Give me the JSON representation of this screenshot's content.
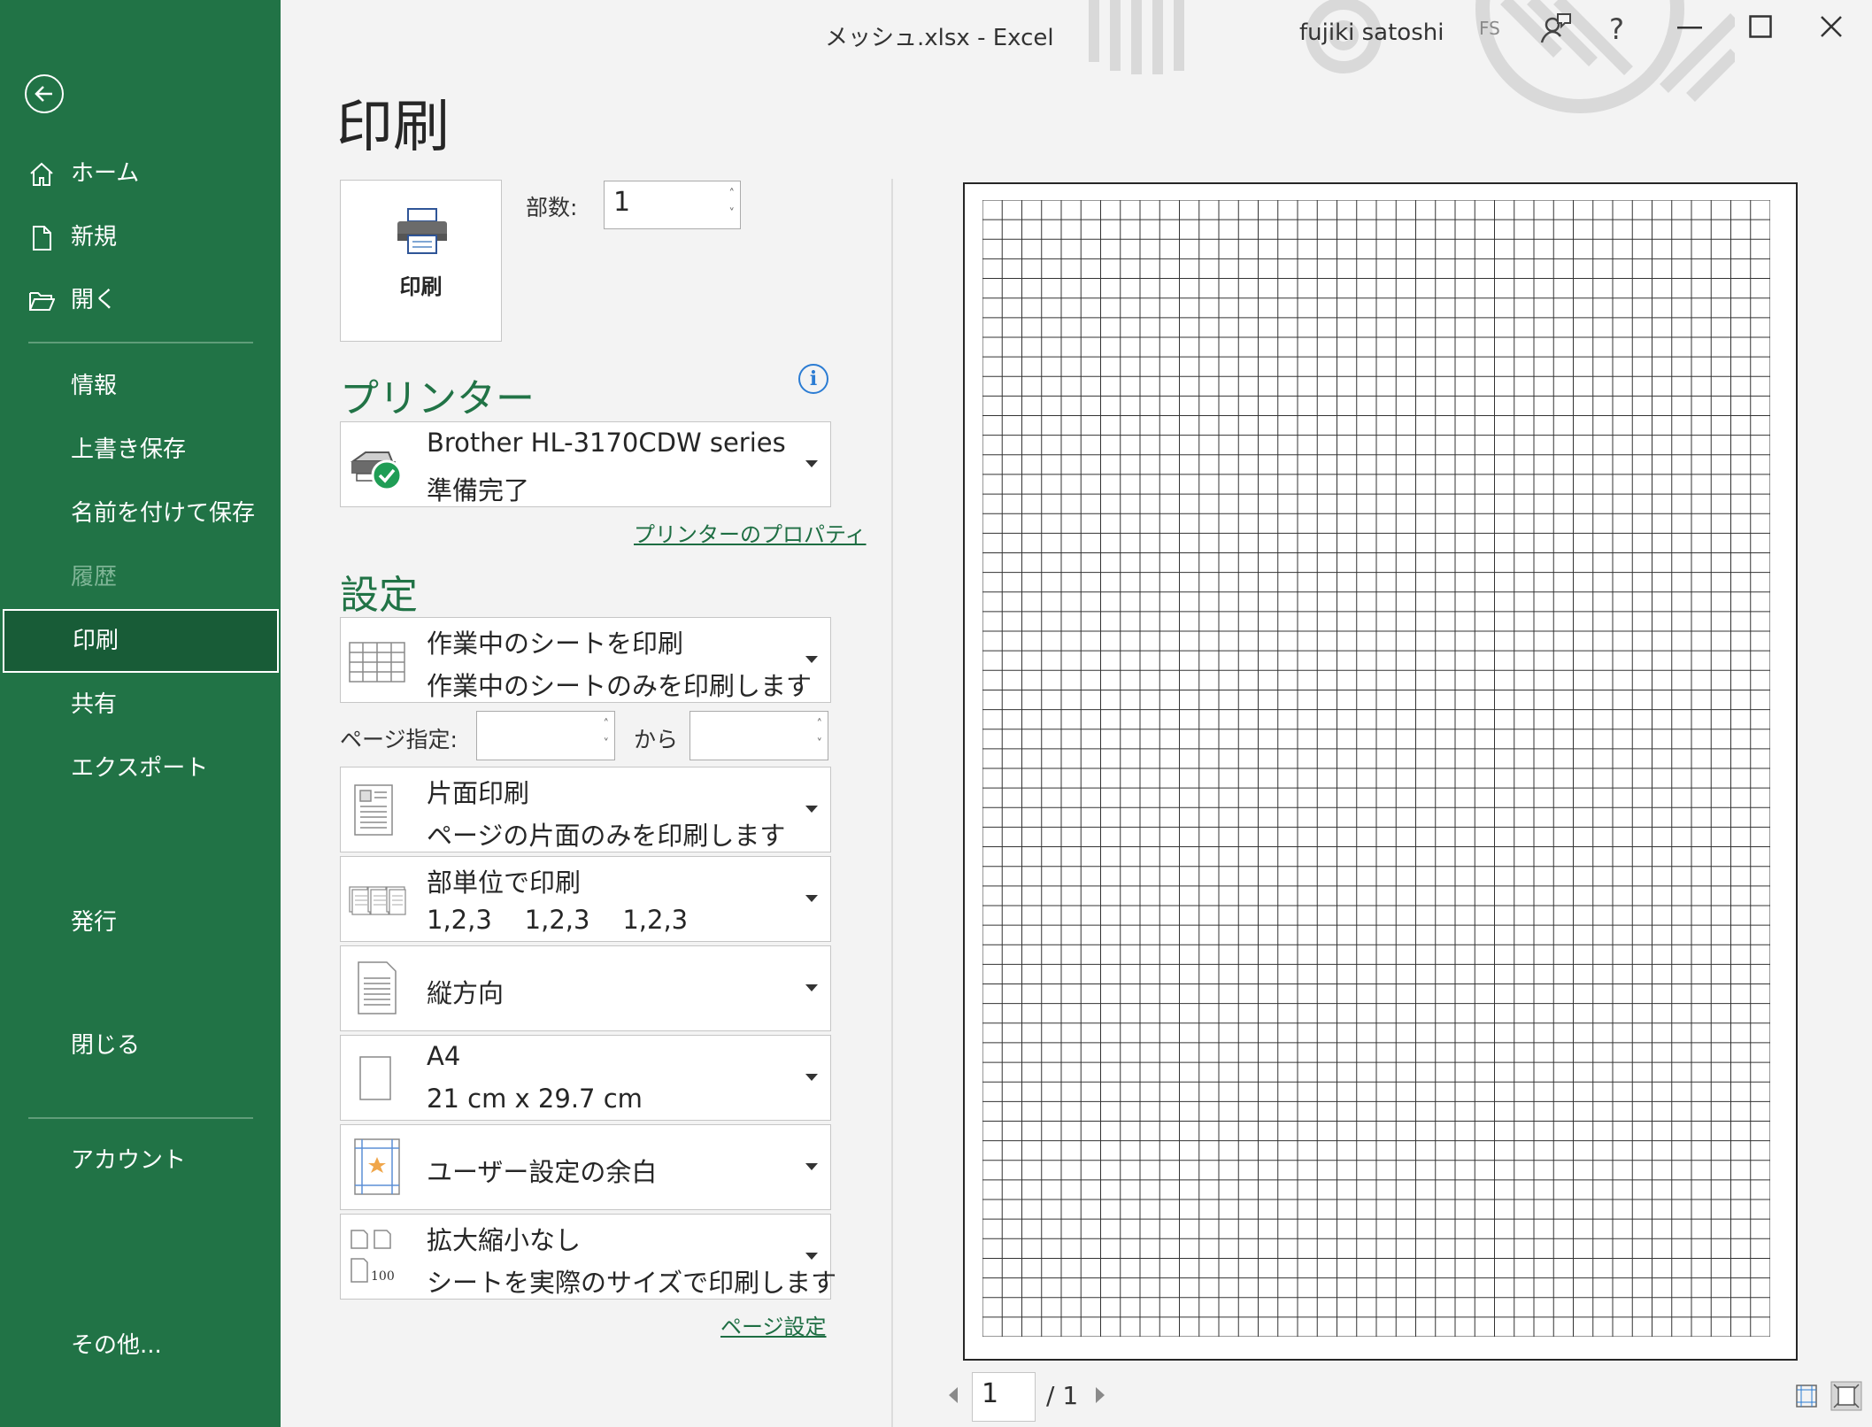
{
  "window": {
    "title": "メッシュ.xlsx  -  Excel",
    "user_name": "fujiki satoshi",
    "user_initials": "FS",
    "help": "?"
  },
  "sidebar": {
    "items": [
      {
        "label": "ホーム"
      },
      {
        "label": "新規"
      },
      {
        "label": "開く"
      },
      {
        "label": "情報"
      },
      {
        "label": "上書き保存"
      },
      {
        "label": "名前を付けて保存"
      },
      {
        "label": "履歴"
      },
      {
        "label": "印刷"
      },
      {
        "label": "共有"
      },
      {
        "label": "エクスポート"
      },
      {
        "label": "発行"
      },
      {
        "label": "閉じる"
      },
      {
        "label": "アカウント"
      },
      {
        "label": "その他..."
      }
    ]
  },
  "print": {
    "title": "印刷",
    "button_label": "印刷",
    "copies_label": "部数:",
    "copies_value": "1"
  },
  "printer": {
    "section_title": "プリンター",
    "name": "Brother HL-3170CDW series",
    "status": "準備完了",
    "properties_link": "プリンターのプロパティ"
  },
  "settings": {
    "section_title": "設定",
    "what": {
      "line1": "作業中のシートを印刷",
      "line2": "作業中のシートのみを印刷します"
    },
    "pages_label": "ページ指定:",
    "pages_to_label": "から",
    "sides": {
      "line1": "片面印刷",
      "line2": "ページの片面のみを印刷します"
    },
    "collate": {
      "line1": "部単位で印刷",
      "line2": "1,2,3    1,2,3    1,2,3"
    },
    "orientation": {
      "line1": "縦方向"
    },
    "paper": {
      "line1": "A4",
      "line2": "21 cm x 29.7 cm"
    },
    "margins": {
      "line1": "ユーザー設定の余白"
    },
    "scaling": {
      "line1": "拡大縮小なし",
      "line2": "シートを実際のサイズで印刷します",
      "icon_text": "100"
    },
    "page_setup_link": "ページ設定"
  },
  "preview": {
    "current_page": "1",
    "total_pages": "/ 1"
  }
}
